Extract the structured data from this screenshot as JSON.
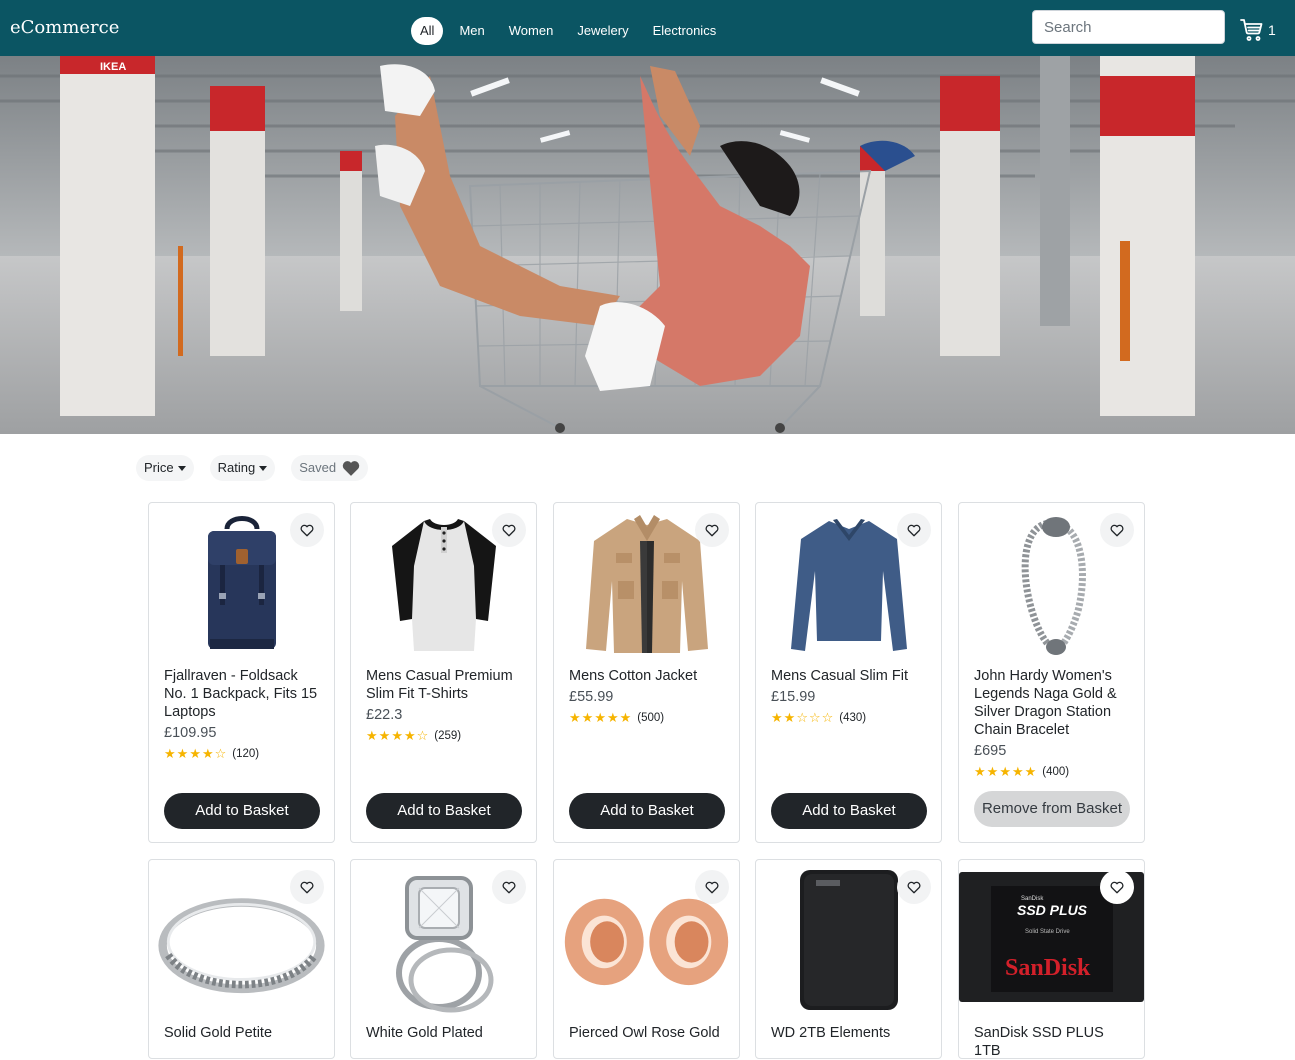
{
  "brand": "eCommerce",
  "nav": {
    "links": [
      "All",
      "Men",
      "Women",
      "Jewelery",
      "Electronics"
    ],
    "active": 0
  },
  "search": {
    "placeholder": "Search",
    "value": ""
  },
  "cart": {
    "count": "1"
  },
  "filters": {
    "price": "Price",
    "rating": "Rating",
    "saved": "Saved"
  },
  "colors": {
    "navbar": "#0b5563",
    "button": "#212529",
    "star": "#f6b400",
    "remove_button": "#d5d6d7"
  },
  "products": [
    {
      "title": "Fjallraven - Foldsack No. 1 Backpack, Fits 15 Laptops",
      "price": "£109.95",
      "rating": 4,
      "count": "(120)",
      "action": "Add to Basket",
      "icon": "backpack-image"
    },
    {
      "title": "Mens Casual Premium Slim Fit T-Shirts",
      "price": "£22.3",
      "rating": 4,
      "count": "(259)",
      "action": "Add to Basket",
      "icon": "tshirt-image"
    },
    {
      "title": "Mens Cotton Jacket",
      "price": "£55.99",
      "rating": 5,
      "count": "(500)",
      "action": "Add to Basket",
      "icon": "jacket-image"
    },
    {
      "title": "Mens Casual Slim Fit",
      "price": "£15.99",
      "rating": 2,
      "count": "(430)",
      "action": "Add to Basket",
      "icon": "longsleeve-image"
    },
    {
      "title": "John Hardy Women's Legends Naga Gold & Silver Dragon Station Chain Bracelet",
      "price": "£695",
      "rating": 5,
      "count": "(400)",
      "action": "Remove from Basket",
      "icon": "bracelet-image"
    },
    {
      "title": "Solid Gold Petite",
      "icon": "ring-image"
    },
    {
      "title": "White Gold Plated",
      "icon": "diamond-ring-image"
    },
    {
      "title": "Pierced Owl Rose Gold",
      "icon": "earrings-image"
    },
    {
      "title": "WD 2TB Elements",
      "icon": "hard-drive-image"
    },
    {
      "title": "SanDisk SSD PLUS 1TB",
      "icon": "ssd-image",
      "logo_text": "SSD PLUS",
      "brand_text": "SanDisk"
    }
  ]
}
